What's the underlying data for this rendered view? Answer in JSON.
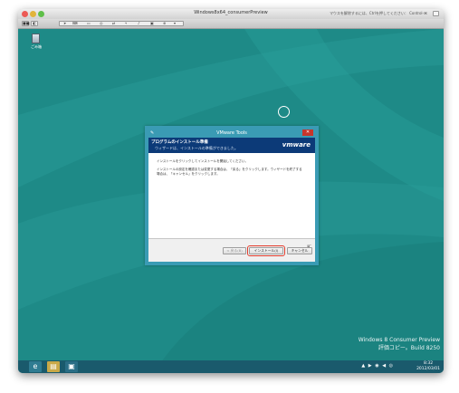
{
  "mac_window": {
    "title": "Windows8x64_consumerPreview",
    "tip": "マウスを解除するには、Ctrlを押してください： Control-⌘"
  },
  "toolbar": {
    "b1": "■■",
    "b2": "◧"
  },
  "desktop": {
    "recycle_bin_label": "ごみ箱",
    "watermark_line1": "Windows 8 Consumer Preview",
    "watermark_line2": "評価コピー。Build 8250"
  },
  "dialog": {
    "title": "VMware Tools",
    "close_label": "✕",
    "header_heading": "プログラムのインストール準備",
    "header_sub": "ウィザードは、インストールの準備ができました。",
    "logo": "vmware",
    "body_line1": "インストールをクリックしてインストールを開始してください。",
    "body_line2a": "インストールの設定を確認または変更する場合は、「戻る」をクリックします。ウィザードを終了する",
    "body_line2b": "場合は、「キャンセル」をクリックします。",
    "btn_back": "< 戻る(B)",
    "btn_install": "インストール(I)",
    "btn_cancel": "キャンセル"
  },
  "taskbar": {
    "ie_glyph": "e",
    "explorer_glyph": "▤",
    "vmw_glyph": "▣",
    "tray": "▲ ▶ ◉ ◀ ◎",
    "time": "8:32",
    "date": "2012/03/01"
  }
}
